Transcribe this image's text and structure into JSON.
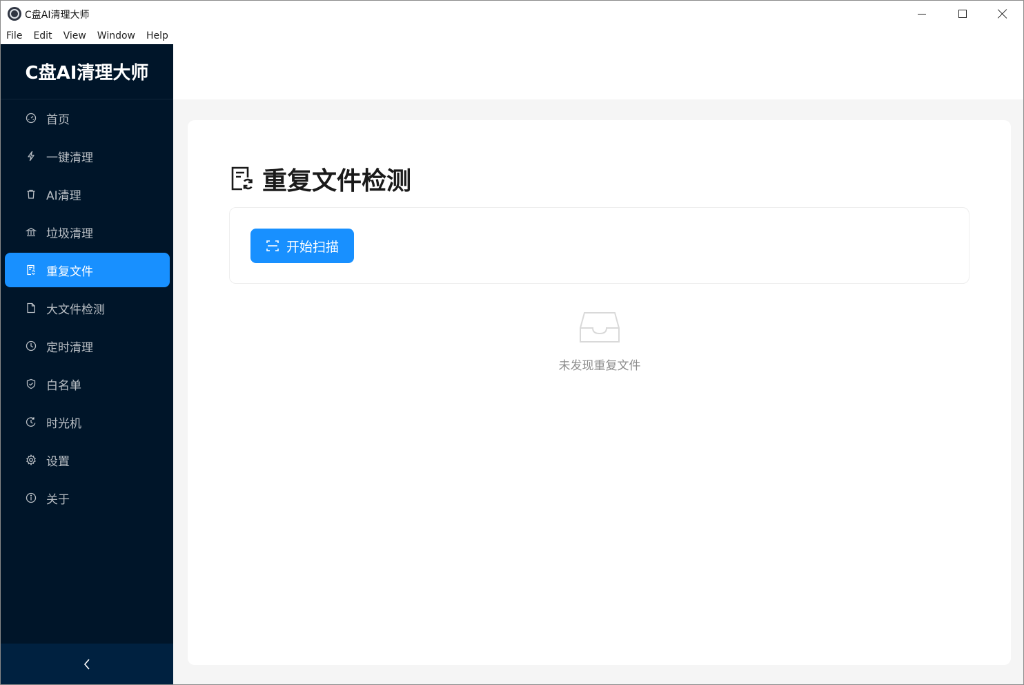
{
  "window": {
    "title": "C盘AI清理大师",
    "controls": {
      "minimize": "minimize-icon",
      "maximize": "maximize-icon",
      "close": "close-icon"
    }
  },
  "menubar": {
    "items": [
      {
        "label": "File"
      },
      {
        "label": "Edit"
      },
      {
        "label": "View"
      },
      {
        "label": "Window"
      },
      {
        "label": "Help"
      }
    ]
  },
  "sidebar": {
    "brand": "C盘AI清理大师",
    "active_color": "#1890ff",
    "background": "#001529",
    "items": [
      {
        "label": "首页",
        "icon": "dashboard-icon"
      },
      {
        "label": "一键清理",
        "icon": "lightning-icon"
      },
      {
        "label": "AI清理",
        "icon": "trash-icon"
      },
      {
        "label": "垃圾清理",
        "icon": "bank-icon"
      },
      {
        "label": "重复文件",
        "icon": "file-sync-icon",
        "active": true
      },
      {
        "label": "大文件检测",
        "icon": "file-icon"
      },
      {
        "label": "定时清理",
        "icon": "clock-icon"
      },
      {
        "label": "白名单",
        "icon": "safety-icon"
      },
      {
        "label": "时光机",
        "icon": "history-icon"
      },
      {
        "label": "设置",
        "icon": "gear-icon"
      },
      {
        "label": "关于",
        "icon": "info-icon"
      }
    ],
    "collapse_icon": "chevron-left-icon"
  },
  "main": {
    "title": "重复文件检测",
    "title_icon": "file-sync-icon",
    "scan_button": {
      "label": "开始扫描",
      "icon": "scan-icon"
    },
    "empty": {
      "icon": "inbox-icon",
      "text": "未发现重复文件"
    }
  }
}
